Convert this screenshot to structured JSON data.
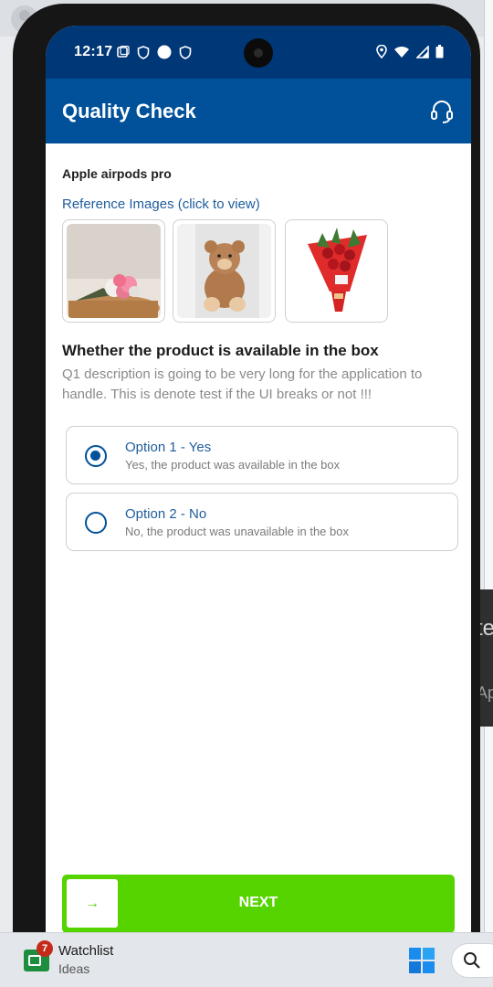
{
  "status_bar": {
    "time": "12:17"
  },
  "app": {
    "title": "Quality Check"
  },
  "product": {
    "name": "Apple airpods pro",
    "reference_link": "Reference Images (click to view)"
  },
  "question": {
    "title": "Whether the product is available in the box",
    "description": "Q1 description is going to be very long for the application to handle. This is denote test if the UI breaks or not !!!"
  },
  "options": [
    {
      "title": "Option 1 - Yes",
      "subtitle": "Yes, the product was available in the box",
      "selected": true
    },
    {
      "title": "Option 2 - No",
      "subtitle": "No, the product was unavailable in the box",
      "selected": false
    }
  ],
  "next_button": {
    "label": "NEXT"
  },
  "taskbar": {
    "widget_title": "Watchlist",
    "widget_subtitle": "Ideas",
    "badge_count": "7"
  },
  "background_fragments": {
    "text1": "te",
    "text2": "Ap"
  },
  "colors": {
    "primary": "#00519a",
    "status_bar": "#003776",
    "accent_green": "#55d400",
    "link_blue": "#1f5d9c"
  }
}
